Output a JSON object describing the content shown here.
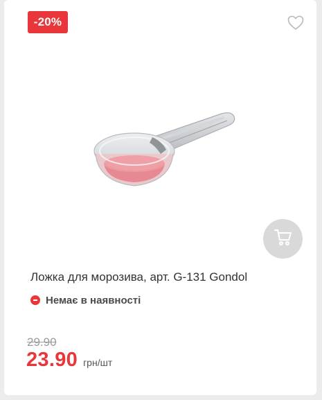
{
  "product": {
    "discount_badge": "-20%",
    "title": "Ложка для морозива, арт. G-131 Gondol",
    "stock_status": "Немає в наявності",
    "old_price": "29.90",
    "price": "23.90",
    "unit": "грн/шт",
    "image_description_icon": "ice-cream-scoop-image"
  },
  "icons": {
    "favorite": "heart-icon",
    "cart": "cart-icon",
    "stock": "out-of-stock-icon"
  },
  "colors": {
    "accent": "#e8363a",
    "cart_button_bg": "#d9d9d9",
    "background": "#ececec",
    "card": "#ffffff"
  }
}
